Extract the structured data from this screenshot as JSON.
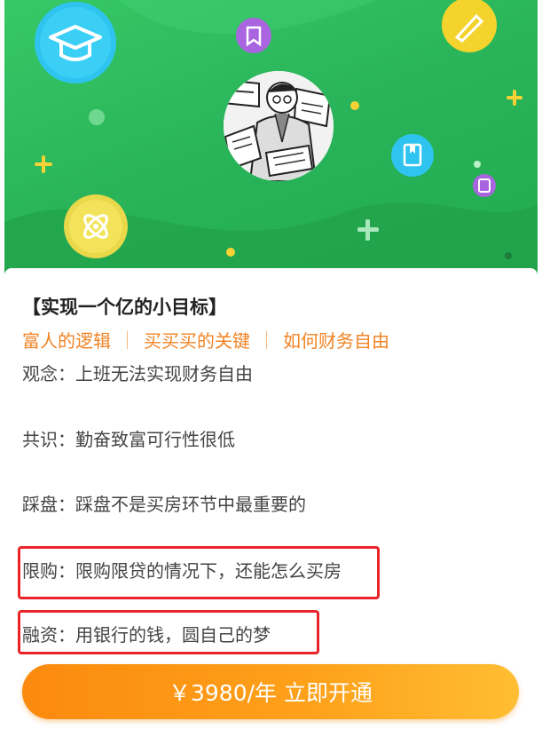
{
  "header": {
    "icons": [
      "graduation-cap-icon",
      "bookmark-icon",
      "paintbrush-icon",
      "atom-icon",
      "book-icon",
      "note-icon",
      "plus-icon"
    ],
    "avatar_desc": "cartoon-avatar"
  },
  "course": {
    "title": "【实现一个亿的小目标】",
    "tags": [
      "富人的逻辑",
      "买买买的关键",
      "如何财务自由"
    ],
    "points": [
      {
        "label": "观念",
        "sep": "：",
        "text": "上班无法实现财务自由"
      },
      {
        "label": "共识",
        "sep": "：",
        "text": "勤奋致富可行性很低"
      },
      {
        "label": "踩盘",
        "sep": "：",
        "text": "踩盘不是买房环节中最重要的"
      },
      {
        "label": "限购",
        "sep": "：",
        "text": "限购限贷的情况下，还能怎么买房"
      },
      {
        "label": "融资",
        "sep": "：",
        "text": "用银行的钱，圆自己的梦"
      }
    ]
  },
  "cta": {
    "label": "￥3980/年 立即开通"
  },
  "colors": {
    "brand_green": "#2ab55a",
    "tag_orange": "#f18425",
    "cta_orange": "#fb8a0e",
    "highlight_red": "#e8242a"
  }
}
